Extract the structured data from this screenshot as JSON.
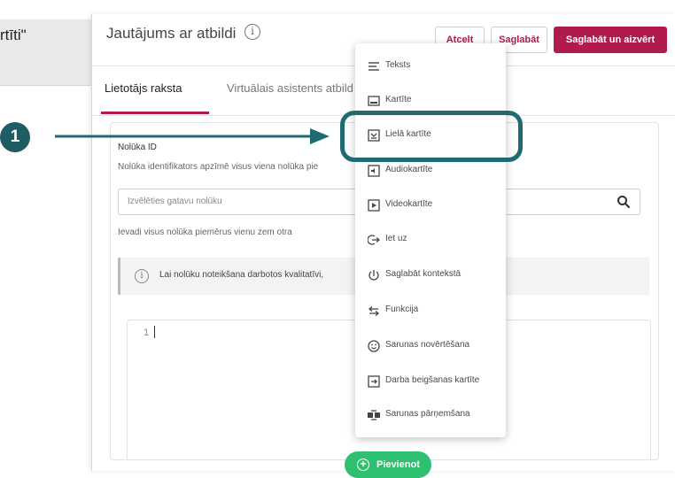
{
  "background_fragment": "rtīti\"",
  "header": {
    "title": "Jautājums ar atbildi",
    "info_glyph": "i",
    "buttons": {
      "cancel": "Atcelt",
      "save": "Saglabāt",
      "save_close": "Saglabāt un aizvērt"
    }
  },
  "tabs": [
    {
      "label": "Lietotājs raksta"
    },
    {
      "label": "Virtuālais asistents atbild"
    }
  ],
  "form": {
    "field_label": "Nolūka ID",
    "field_description": "Nolūka identifikators apzīmē visus viena nolūka pie",
    "select_placeholder": "Izvēlēties gatavu nolūku",
    "hint": "Ievadi visus nolūka piemērus vienu zem otra",
    "info_text": "Lai nolūku noteikšana darbotos kvalitatīvi,",
    "info_glyph": "i",
    "editor_line_number": "1"
  },
  "add_button": {
    "label": "Pievienot",
    "icon": "plus-circle-icon"
  },
  "menu": {
    "items": [
      {
        "label": "Teksts",
        "icon": "text-lines-icon"
      },
      {
        "label": "Kartīte",
        "icon": "card-icon"
      },
      {
        "label": "Lielā kartīte",
        "icon": "large-card-icon"
      },
      {
        "label": "Audiokartīte",
        "icon": "audio-card-icon"
      },
      {
        "label": "Videokartīte",
        "icon": "video-card-icon"
      },
      {
        "label": "Iet uz",
        "icon": "goto-arrow-icon"
      },
      {
        "label": "Saglabāt kontekstā",
        "icon": "save-context-icon"
      },
      {
        "label": "Funkcija",
        "icon": "function-arrows-icon"
      },
      {
        "label": "Sarunas novērtēšana",
        "icon": "smiley-icon"
      },
      {
        "label": "Darba beigšanas kartīte",
        "icon": "end-card-icon"
      },
      {
        "label": "Sarunas pārņemšana",
        "icon": "handover-icon"
      }
    ]
  },
  "annotation": {
    "step_number": "1"
  },
  "colors": {
    "accent": "#b01b4b",
    "annotation": "#1f6b72",
    "add_button": "#2fbf71"
  }
}
